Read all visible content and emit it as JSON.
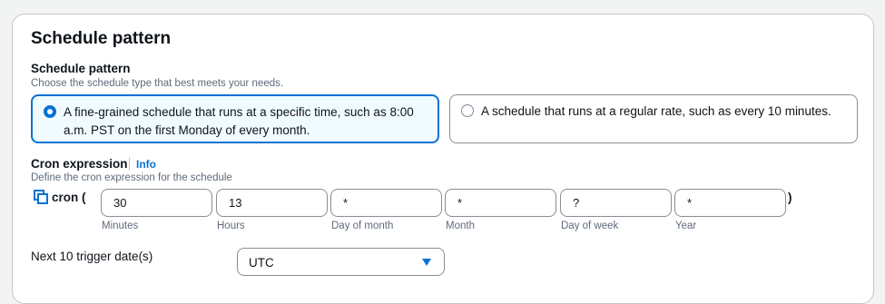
{
  "section": {
    "title": "Schedule pattern"
  },
  "schedule_pattern": {
    "label": "Schedule pattern",
    "description": "Choose the schedule type that best meets your needs.",
    "options": [
      {
        "label": "A fine-grained schedule that runs at a specific time, such as 8:00 a.m. PST on the first Monday of every month.",
        "selected": true
      },
      {
        "label": "A schedule that runs at a regular rate, such as every 10 minutes.",
        "selected": false
      }
    ]
  },
  "cron": {
    "label": "Cron expression",
    "info_link": "Info",
    "description": "Define the cron expression for the schedule",
    "prefix": "cron (",
    "suffix": ")",
    "copy_icon": "copy-icon",
    "fields": [
      {
        "value": "30",
        "label": "Minutes"
      },
      {
        "value": "13",
        "label": "Hours"
      },
      {
        "value": "*",
        "label": "Day of month"
      },
      {
        "value": "*",
        "label": "Month"
      },
      {
        "value": "?",
        "label": "Day of week"
      },
      {
        "value": "*",
        "label": "Year"
      }
    ]
  },
  "trigger": {
    "label": "Next 10 trigger date(s)",
    "timezone": "UTC"
  },
  "colors": {
    "accent": "#0972d3",
    "selected_bg": "#f0fbff"
  }
}
